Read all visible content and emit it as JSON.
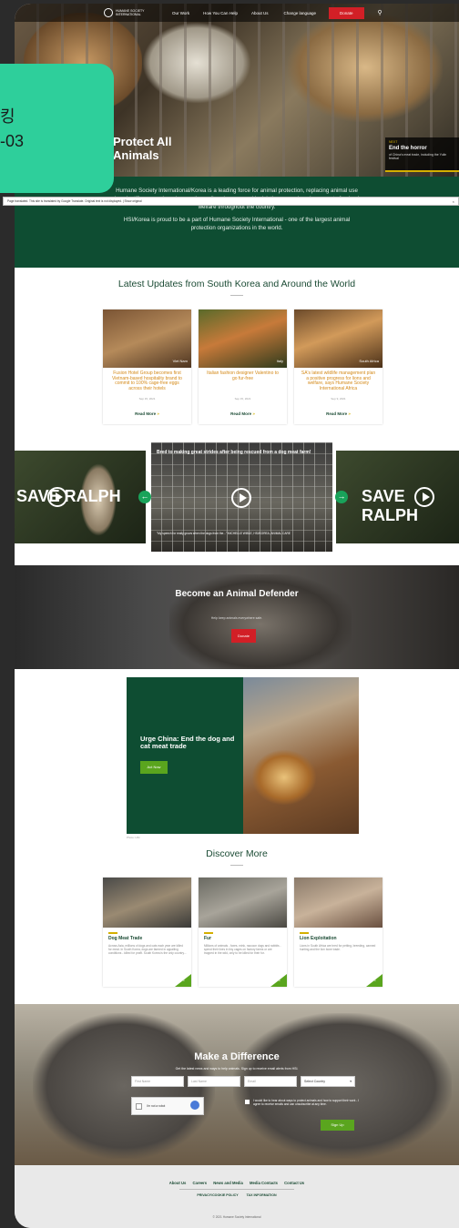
{
  "nav": {
    "logo_text": "HUMANE SOCIETY INTERNATIONAL",
    "items": [
      "Our Work",
      "How You Can Help",
      "About Us",
      "Change language"
    ],
    "donate": "Donate"
  },
  "hero": {
    "title": "Protect All Animals",
    "next_kicker": "NEXT",
    "next_title": "End the horror",
    "next_desc": "of China's meat trade, including the Yulin festival"
  },
  "translate_bar": "Page translated. This site is translated by Google Translate. Original text is not displayed. | Show original",
  "overlay_badge": {
    "line1": "킹",
    "line2": "-03"
  },
  "intro": {
    "p1": "Humane Society International/Korea is a leading force for animal protection, replacing animal use in scientific research and promoting policy changes and legislative campaigns in support of animal welfare throughout the country.",
    "p2": "HSI/Korea is proud to be a part of Humane Society International - one of the largest animal protection organizations in the world."
  },
  "latest": {
    "heading": "Latest Updates from South Korea and Around the World",
    "cards": [
      {
        "tag": "Viet Nam",
        "desc": "Fusion Hotel Group becomes first Vietnam-based hospitality brand to commit to 100% cage-free eggs across their hotels",
        "date": "Sep 15, 2021",
        "more": "Read More"
      },
      {
        "tag": "Italy",
        "desc": "Italian fashion designer Valentino to go fur-free",
        "date": "Sep 15, 2021",
        "more": "Read More"
      },
      {
        "tag": "South Africa",
        "desc": "SA's latest wildlife management plan a positive progress for lions and welfare, says Humane Society International Africa",
        "date": "Sep 9, 2021",
        "more": "Read More"
      }
    ]
  },
  "videos": {
    "center_title": "Bred to making great strides after being rescued from a dog meat farm!",
    "center_caption": "\"My speech for really grows when the dogs from the...\" MICHELLE WIBLE, HSI/KOREA, ANIMAL CARE",
    "side_title": "SAVE RALPH"
  },
  "defender": {
    "title": "Become an Animal Defender",
    "subtitle": "Help keep animals everywhere safe.",
    "button": "Donate"
  },
  "campaign": {
    "title": "Urge China: End the dog and cat meat trade",
    "button": "Act Now",
    "credit": "Photo: HSI"
  },
  "discover": {
    "heading": "Discover More",
    "cards": [
      {
        "title": "Dog Meat Trade",
        "desc": "Across Asia, millions of dogs and cats each year are killed for meat. In South Korea, dogs are farmed in appalling conditions - killed for profit. South Korea is the only country..."
      },
      {
        "title": "Fur",
        "desc": "Millions of animals - foxes, mink, raccoon dogs and rabbits - spend their lives in tiny cages on factory farms or are trapped in the wild, only to be killed for their fur."
      },
      {
        "title": "Lion Exploitation",
        "desc": "Lions in South Africa are bred for petting, breeding, canned hunting and the lion bone trade."
      }
    ]
  },
  "signup": {
    "title": "Make a Difference",
    "subtitle": "Get the latest news and ways to help animals. Sign up to receive email alerts from HSI.",
    "first_name": "First Name",
    "last_name": "Last Name",
    "email": "Email",
    "country": "Select Country",
    "captcha": "I'm not a robot",
    "consent": "I would like to hear about ways to protect animals and how to support their work - I agree to receive emails and can unsubscribe at any time.",
    "button": "Sign Up"
  },
  "footer": {
    "links": [
      "About Us",
      "Careers",
      "News and Media",
      "Media Contacts",
      "Contact Us"
    ],
    "links2": [
      "PRIVACY/COOKIE POLICY",
      "TAX INFORMATION"
    ],
    "copyright": "© 2021 Humane Society International"
  }
}
